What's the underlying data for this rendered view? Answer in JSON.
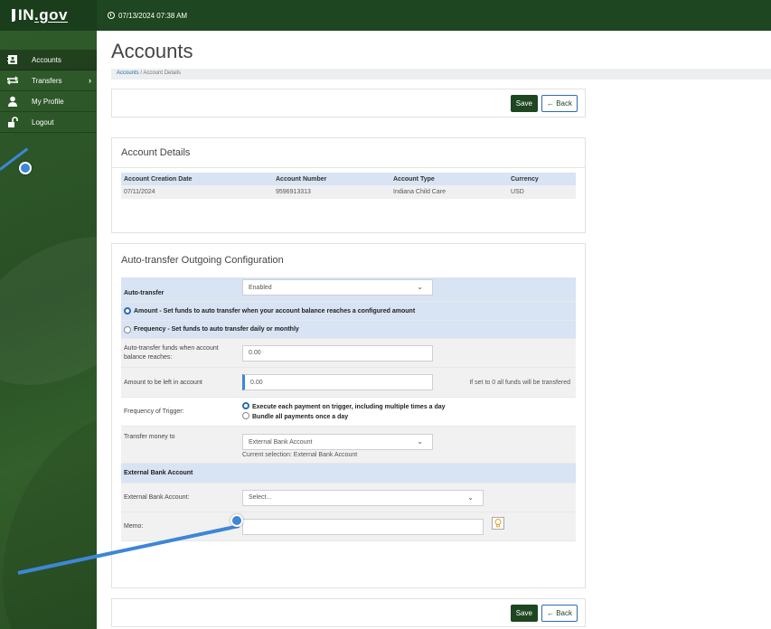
{
  "header": {
    "logo_main": "IN",
    "logo_gov": ".gov",
    "timestamp": "07/13/2024 07:38 AM"
  },
  "sidebar": {
    "items": [
      {
        "label": "Accounts",
        "icon": "contact-card-icon",
        "active": true
      },
      {
        "label": "Transfers",
        "icon": "transfer-arrows-icon",
        "has_submenu": true
      },
      {
        "label": "My Profile",
        "icon": "user-profile-icon"
      },
      {
        "label": "Logout",
        "icon": "unlock-icon"
      }
    ]
  },
  "page": {
    "title": "Accounts",
    "breadcrumb_root": "Accounts",
    "breadcrumb_sep": "/",
    "breadcrumb_current": "Account Details"
  },
  "toolbar": {
    "save_label": "Save",
    "back_label": "Back"
  },
  "account_details": {
    "heading": "Account Details",
    "columns": [
      "Account Creation Date",
      "Account Number",
      "Account Type",
      "Currency"
    ],
    "row": [
      "07/11/2024",
      "9596913313",
      "Indiana Child Care",
      "USD"
    ]
  },
  "auto_transfer": {
    "heading": "Auto-transfer Outgoing Configuration",
    "auto_transfer_label": "Auto-transfer",
    "auto_transfer_value": "Enabled",
    "option_amount": "Amount - Set funds to auto transfer when your account balance reaches a configured amount",
    "option_frequency": "Frequency - Set funds to auto transfer daily or monthly",
    "threshold_label": "Auto-transfer funds when account balance reaches:",
    "threshold_value": "0.00",
    "leave_label": "Amount to be left in account",
    "leave_value": "0.00",
    "leave_hint": "If set to 0 all funds will be transfered",
    "frequency_label": "Frequency of Trigger:",
    "frequency_opt1": "Execute each payment on trigger, including multiple times a day",
    "frequency_opt2": "Bundle all payments once a day",
    "transfer_to_label": "Transfer money to",
    "transfer_to_value": "External Bank Account",
    "current_selection": "Current selection: External Bank Account",
    "ext_section": "External Bank Account",
    "ext_account_label": "External Bank Account:",
    "ext_account_placeholder": "Select...",
    "memo_label": "Memo:",
    "memo_value": ""
  },
  "colors": {
    "brand_green": "#1e4620",
    "sidebar_green": "#2f5b2a",
    "highlight_blue": "#d8e4f4",
    "annotation_blue": "#3e86d6"
  }
}
